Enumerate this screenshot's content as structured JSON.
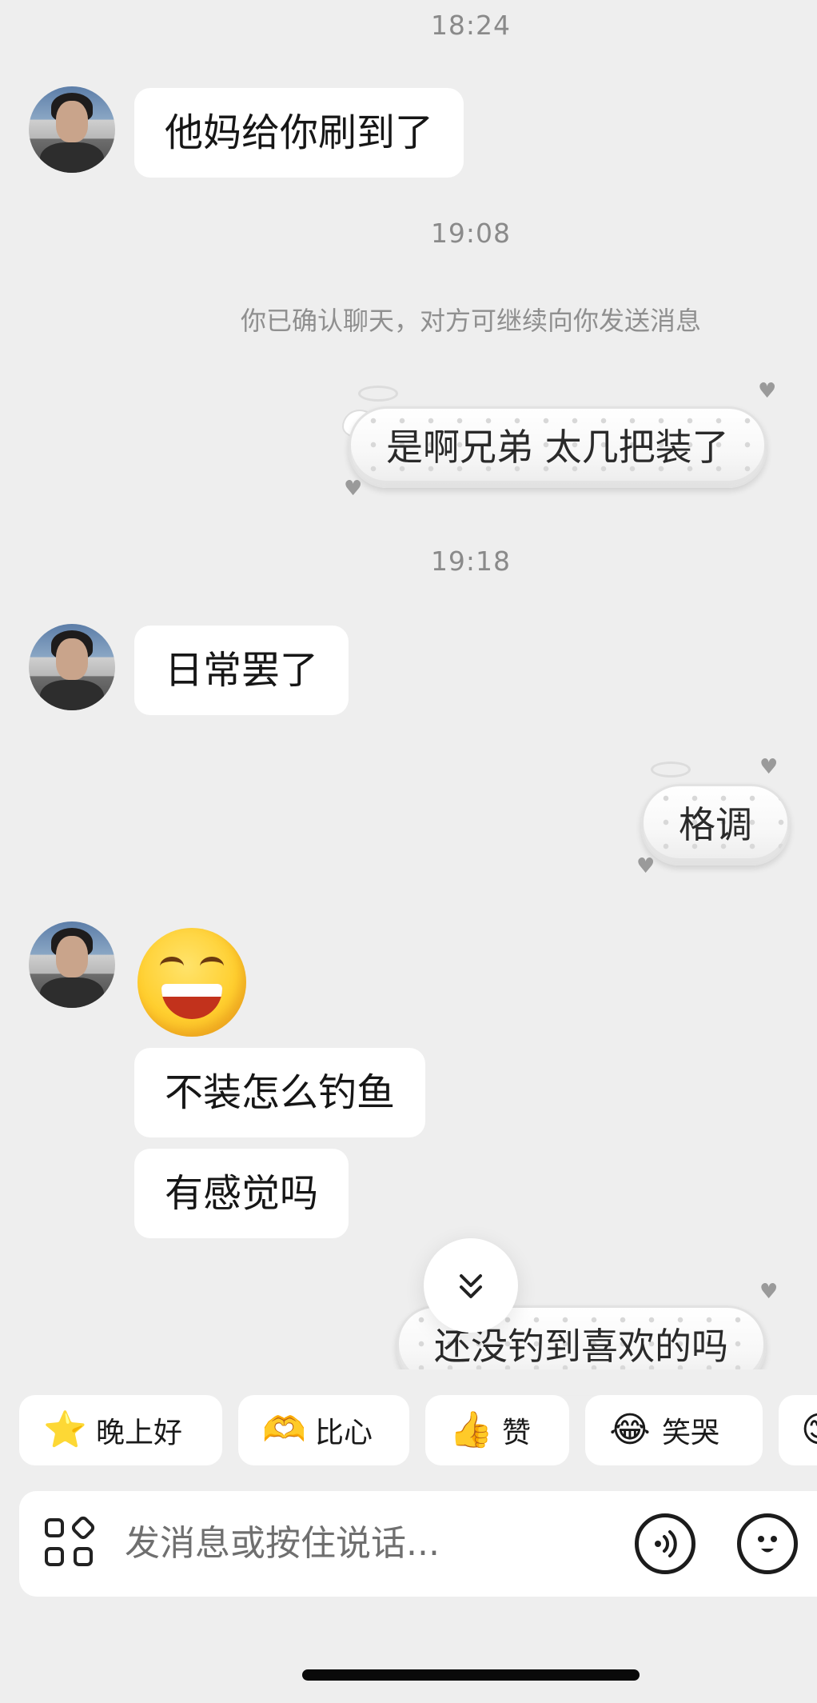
{
  "messages": {
    "ts1": "18:24",
    "msg1": "他妈给你刷到了",
    "ts2": "19:08",
    "system_note": "你已确认聊天，对方可继续向你发送消息",
    "sent1": "是啊兄弟 太几把装了",
    "ts3": "19:18",
    "msg2": "日常罢了",
    "sent2": "格调",
    "sticker": "grinning-face-emoji",
    "msg3": "不装怎么钓鱼",
    "msg4": "有感觉吗",
    "sent3": "还没钓到喜欢的吗"
  },
  "quick_replies": [
    {
      "icon": "star-emoji",
      "label": "晚上好"
    },
    {
      "icon": "heart-hands-emoji",
      "label": "比心"
    },
    {
      "icon": "thumbs-up-emoji",
      "label": "赞"
    },
    {
      "icon": "laugh-cry-emoji",
      "label": "笑哭"
    }
  ],
  "input": {
    "placeholder": "发消息或按住说话..."
  },
  "icons": {
    "apps": "apps-grid-icon",
    "voice": "voice-icon",
    "emoji": "emoji-face-icon",
    "scroll": "double-chevron-down-icon"
  }
}
